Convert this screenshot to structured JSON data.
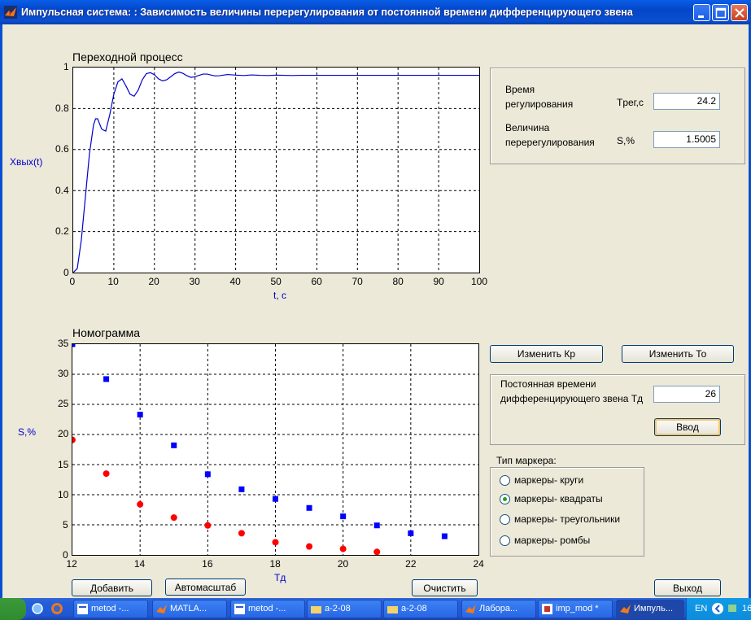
{
  "window": {
    "title": "Импульсная система: : Зависимость величины перерегулирования от постоянной времени дифференцирующего звена"
  },
  "plot1": {
    "title": "Переходной процесс",
    "ylabel": "Xвых(t)",
    "xlabel": "t, c",
    "xticks": [
      "0",
      "10",
      "20",
      "30",
      "40",
      "50",
      "60",
      "70",
      "80",
      "90",
      "100"
    ],
    "yticks": [
      "0",
      "0.2",
      "0.4",
      "0.6",
      "0.8",
      "1"
    ]
  },
  "plot2": {
    "title": "Номограмма",
    "ylabel": "S,%",
    "xlabel": "Tд",
    "xticks": [
      "12",
      "14",
      "16",
      "18",
      "20",
      "22",
      "24"
    ],
    "yticks": [
      "0",
      "5",
      "10",
      "15",
      "20",
      "25",
      "30",
      "35"
    ]
  },
  "chart_data": [
    {
      "type": "line",
      "title": "Переходной процесс",
      "xlabel": "t, c",
      "ylabel": "Xвых(t)",
      "xlim": [
        0,
        100
      ],
      "ylim": [
        0,
        1
      ],
      "grid": true,
      "color": "#0000cc",
      "x": [
        0,
        1,
        2,
        3,
        4,
        5,
        5.5,
        6,
        7,
        8,
        9,
        10,
        11,
        12,
        13,
        14,
        15,
        16,
        17,
        18,
        19,
        20,
        21,
        22,
        23,
        24,
        25,
        26,
        27,
        28,
        29,
        30,
        31,
        32,
        33,
        34,
        35,
        36,
        38,
        40,
        42,
        44,
        46,
        48,
        50,
        52,
        54,
        56,
        58,
        60,
        65,
        70,
        75,
        80,
        85,
        90,
        95,
        100
      ],
      "y": [
        0,
        0.02,
        0.16,
        0.37,
        0.58,
        0.72,
        0.75,
        0.75,
        0.7,
        0.69,
        0.77,
        0.87,
        0.93,
        0.945,
        0.91,
        0.87,
        0.86,
        0.89,
        0.94,
        0.97,
        0.975,
        0.965,
        0.945,
        0.935,
        0.94,
        0.955,
        0.97,
        0.978,
        0.972,
        0.96,
        0.952,
        0.955,
        0.962,
        0.968,
        0.968,
        0.963,
        0.959,
        0.96,
        0.966,
        0.963,
        0.961,
        0.964,
        0.962,
        0.961,
        0.963,
        0.962,
        0.961,
        0.962,
        0.962,
        0.962,
        0.962,
        0.962,
        0.962,
        0.962,
        0.962,
        0.962,
        0.962,
        0.962
      ]
    },
    {
      "type": "scatter",
      "title": "Номограмма",
      "xlabel": "Tд",
      "ylabel": "S,%",
      "xlim": [
        12,
        24
      ],
      "ylim": [
        0,
        35
      ],
      "grid": true,
      "series": [
        {
          "marker": "square",
          "color": "#0000ff",
          "x": [
            12,
            13,
            14,
            15,
            16,
            17,
            18,
            19,
            20,
            21,
            22,
            23
          ],
          "y": [
            35,
            29.2,
            23.3,
            18.2,
            13.4,
            10.9,
            9.3,
            7.8,
            6.4,
            4.9,
            3.6,
            3.1
          ]
        },
        {
          "marker": "circle",
          "color": "#ff0000",
          "x": [
            12,
            13,
            14,
            15,
            16,
            17,
            18,
            19,
            20,
            21
          ],
          "y": [
            19.1,
            13.5,
            8.4,
            6.2,
            4.9,
            3.6,
            2.1,
            1.4,
            1.0,
            0.5
          ]
        }
      ]
    }
  ],
  "results": {
    "time_label_1": "Время",
    "time_label_2": "регулирования",
    "time_symbol": "Tрег,с",
    "time_value": "24.2",
    "over_label_1": "Величина",
    "over_label_2": "перерегулирования",
    "over_symbol": "S,%",
    "over_value": "1.5005"
  },
  "buttons": {
    "change_kp": "Изменить Кр",
    "change_to": "Изменить То",
    "enter": "Ввод",
    "add": "Добавить",
    "autoscale": "Автомасштаб",
    "clear": "Очистить",
    "exit": "Выход"
  },
  "td_panel": {
    "label_1": "Постоянная времени",
    "label_2": "дифференцирующего звена Тд",
    "value": "26"
  },
  "marker_type": {
    "title": "Тип маркера:",
    "options": [
      "маркеры- круги",
      "маркеры- квадраты",
      "маркеры- треугольники",
      "маркеры- ромбы"
    ],
    "selected_index": 1
  },
  "taskbar": {
    "items": [
      "metod -...",
      "MATLA...",
      "metod -...",
      "a-2-08",
      "a-2-08",
      "Лабора...",
      "imp_mod *",
      "Импуль..."
    ],
    "lang": "EN",
    "clock": "16"
  }
}
